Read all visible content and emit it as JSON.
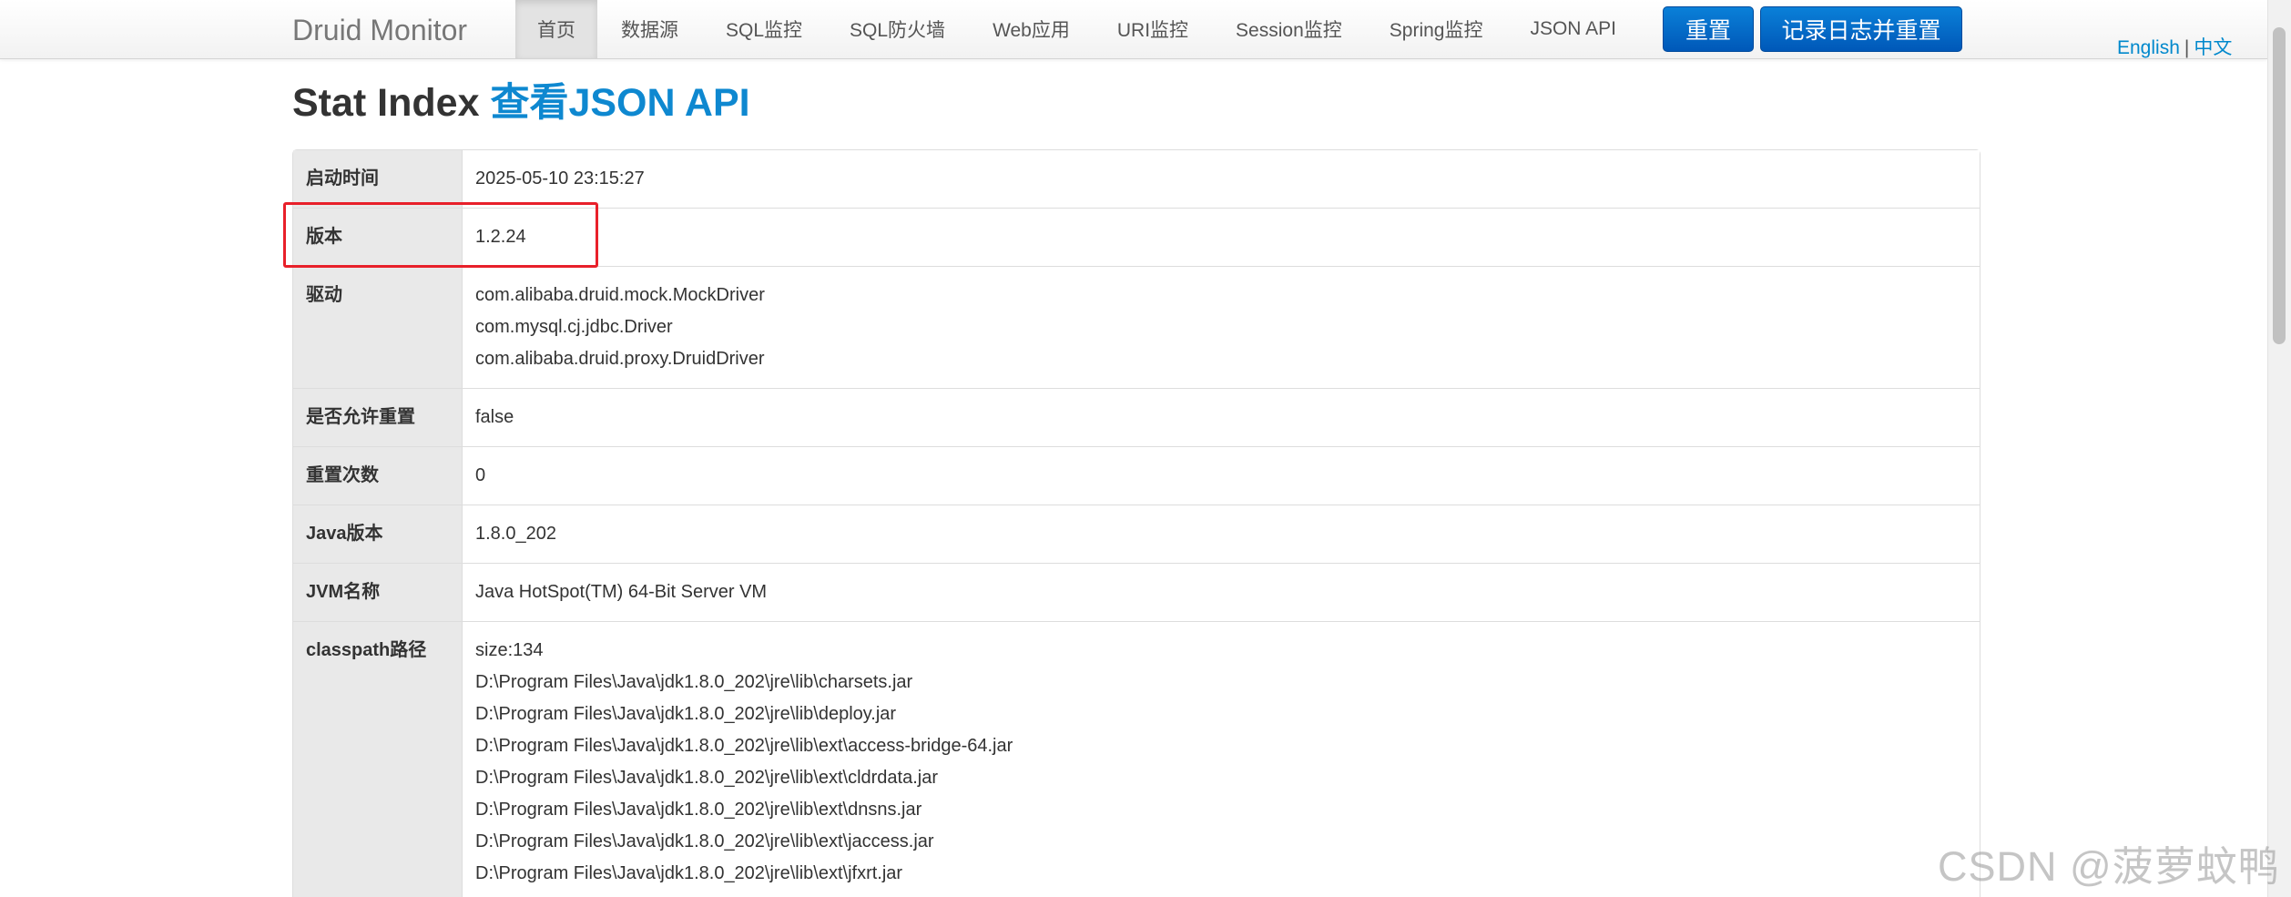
{
  "navbar": {
    "brand": "Druid Monitor",
    "items": [
      {
        "label": "首页",
        "active": true
      },
      {
        "label": "数据源"
      },
      {
        "label": "SQL监控"
      },
      {
        "label": "SQL防火墙"
      },
      {
        "label": "Web应用"
      },
      {
        "label": "URI监控"
      },
      {
        "label": "Session监控"
      },
      {
        "label": "Spring监控"
      },
      {
        "label": "JSON API"
      }
    ],
    "reset_button": "重置",
    "log_reset_button": "记录日志并重置",
    "lang_english": "English",
    "lang_separator": "|",
    "lang_chinese": "中文"
  },
  "heading": {
    "title": "Stat Index",
    "api_link": "查看JSON API"
  },
  "stats": [
    {
      "key": "启动时间",
      "values": [
        "2025-05-10 23:15:27"
      ]
    },
    {
      "key": "版本",
      "values": [
        "1.2.24"
      ]
    },
    {
      "key": "驱动",
      "values": [
        "com.alibaba.druid.mock.MockDriver",
        "com.mysql.cj.jdbc.Driver",
        "com.alibaba.druid.proxy.DruidDriver"
      ]
    },
    {
      "key": "是否允许重置",
      "values": [
        "false"
      ]
    },
    {
      "key": "重置次数",
      "values": [
        "0"
      ]
    },
    {
      "key": "Java版本",
      "values": [
        "1.8.0_202"
      ]
    },
    {
      "key": "JVM名称",
      "values": [
        "Java HotSpot(TM) 64-Bit Server VM"
      ]
    },
    {
      "key": "classpath路径",
      "values": [
        "size:134",
        "D:\\Program Files\\Java\\jdk1.8.0_202\\jre\\lib\\charsets.jar",
        "D:\\Program Files\\Java\\jdk1.8.0_202\\jre\\lib\\deploy.jar",
        "D:\\Program Files\\Java\\jdk1.8.0_202\\jre\\lib\\ext\\access-bridge-64.jar",
        "D:\\Program Files\\Java\\jdk1.8.0_202\\jre\\lib\\ext\\cldrdata.jar",
        "D:\\Program Files\\Java\\jdk1.8.0_202\\jre\\lib\\ext\\dnsns.jar",
        "D:\\Program Files\\Java\\jdk1.8.0_202\\jre\\lib\\ext\\jaccess.jar",
        "D:\\Program Files\\Java\\jdk1.8.0_202\\jre\\lib\\ext\\jfxrt.jar"
      ]
    }
  ],
  "watermark": "CSDN @菠萝蚊鸭",
  "colors": {
    "accent": "#0e88d0",
    "button": "#0068c8",
    "highlight": "#e8202a"
  }
}
